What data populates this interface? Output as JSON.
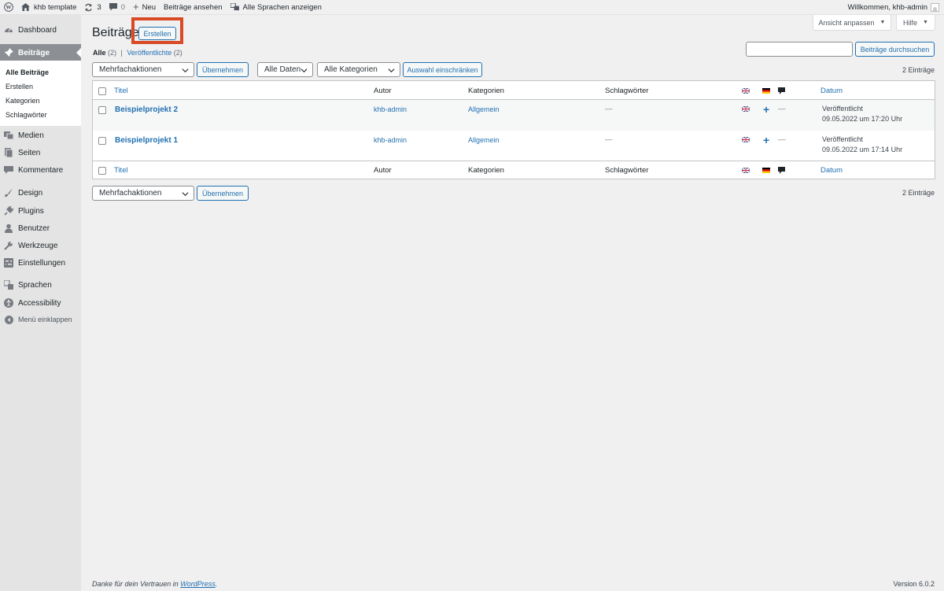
{
  "adminbar": {
    "site_name": "khb template",
    "updates_count": "3",
    "comments_count": "0",
    "new_label": "Neu",
    "view_posts": "Beiträge ansehen",
    "all_languages": "Alle Sprachen anzeigen",
    "greeting": "Willkommen, khb-admin"
  },
  "sidebar": {
    "dashboard": "Dashboard",
    "posts": "Beiträge",
    "submenu": [
      "Alle Beiträge",
      "Erstellen",
      "Kategorien",
      "Schlagwörter"
    ],
    "media": "Medien",
    "pages": "Seiten",
    "comments": "Kommentare",
    "design": "Design",
    "plugins": "Plugins",
    "users": "Benutzer",
    "tools": "Werkzeuge",
    "settings": "Einstellungen",
    "languages": "Sprachen",
    "accessibility": "Accessibility",
    "collapse": "Menü einklappen"
  },
  "screen_meta": {
    "screen_options": "Ansicht anpassen",
    "help": "Hilfe"
  },
  "page": {
    "title": "Beiträge",
    "add_new": "Erstellen"
  },
  "filters": {
    "all_label": "Alle",
    "all_count": "(2)",
    "separator": "|",
    "published_label": "Veröffentlichte",
    "published_count": "(2)",
    "search_button": "Beiträge durchsuchen",
    "bulk_actions": "Mehrfachaktionen",
    "apply": "Übernehmen",
    "all_dates": "Alle Daten",
    "all_categories": "Alle Kategorien",
    "filter_button": "Auswahl einschränken",
    "items_count": "2 Einträge"
  },
  "table": {
    "columns": {
      "title": "Titel",
      "author": "Autor",
      "categories": "Kategorien",
      "tags": "Schlagwörter",
      "date": "Datum"
    },
    "rows": [
      {
        "title": "Beispielprojekt 2",
        "author": "khb-admin",
        "category": "Allgemein",
        "tags": "—",
        "comments": "—",
        "status": "Veröffentlicht",
        "date": "09.05.2022 um 17:20 Uhr"
      },
      {
        "title": "Beispielprojekt 1",
        "author": "khb-admin",
        "category": "Allgemein",
        "tags": "—",
        "comments": "—",
        "status": "Veröffentlicht",
        "date": "09.05.2022 um 17:14 Uhr"
      }
    ]
  },
  "footer": {
    "thanks_prefix": "Danke für dein Vertrauen in ",
    "thanks_link": "WordPress",
    "thanks_suffix": ".",
    "version": "Version 6.0.2"
  },
  "colors": {
    "accent": "#2271b1",
    "highlight": "#d94a25",
    "sidebar_active": "#8c8f94"
  }
}
